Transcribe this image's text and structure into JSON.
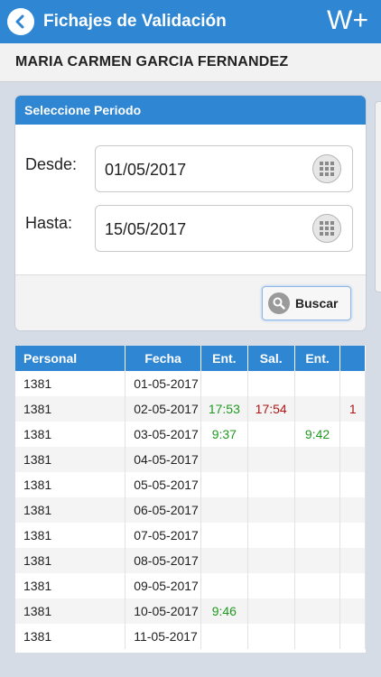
{
  "header": {
    "title": "Fichajes de Validación",
    "logo": "W+",
    "back_icon": "chevron-left-icon"
  },
  "user": {
    "name": "MARIA CARMEN GARCIA FERNANDEZ"
  },
  "period": {
    "title": "Seleccione Periodo",
    "from_label": "Desde:",
    "from_value": "01/05/2017",
    "to_label": "Hasta:",
    "to_value": "15/05/2017",
    "search_label": "Buscar"
  },
  "table": {
    "headers": [
      "Personal",
      "Fecha",
      "Ent.",
      "Sal.",
      "Ent."
    ],
    "rows": [
      {
        "personal": "1381",
        "fecha": "01-05-2017",
        "ent1": "",
        "sal1": "",
        "ent2": "",
        "extra": ""
      },
      {
        "personal": "1381",
        "fecha": "02-05-2017",
        "ent1": "17:53",
        "sal1": "17:54",
        "ent2": "",
        "extra": "1"
      },
      {
        "personal": "1381",
        "fecha": "03-05-2017",
        "ent1": "9:37",
        "sal1": "",
        "ent2": "9:42",
        "extra": ""
      },
      {
        "personal": "1381",
        "fecha": "04-05-2017",
        "ent1": "",
        "sal1": "",
        "ent2": "",
        "extra": ""
      },
      {
        "personal": "1381",
        "fecha": "05-05-2017",
        "ent1": "",
        "sal1": "",
        "ent2": "",
        "extra": ""
      },
      {
        "personal": "1381",
        "fecha": "06-05-2017",
        "ent1": "",
        "sal1": "",
        "ent2": "",
        "extra": ""
      },
      {
        "personal": "1381",
        "fecha": "07-05-2017",
        "ent1": "",
        "sal1": "",
        "ent2": "",
        "extra": ""
      },
      {
        "personal": "1381",
        "fecha": "08-05-2017",
        "ent1": "",
        "sal1": "",
        "ent2": "",
        "extra": ""
      },
      {
        "personal": "1381",
        "fecha": "09-05-2017",
        "ent1": "",
        "sal1": "",
        "ent2": "",
        "extra": ""
      },
      {
        "personal": "1381",
        "fecha": "10-05-2017",
        "ent1": "9:46",
        "sal1": "",
        "ent2": "",
        "extra": ""
      },
      {
        "personal": "1381",
        "fecha": "11-05-2017",
        "ent1": "",
        "sal1": "",
        "ent2": "",
        "extra": ""
      }
    ]
  },
  "colors": {
    "primary": "#2f86d2",
    "entry": "#1f9a1f",
    "exit": "#b01515",
    "background": "#d6dce5"
  }
}
